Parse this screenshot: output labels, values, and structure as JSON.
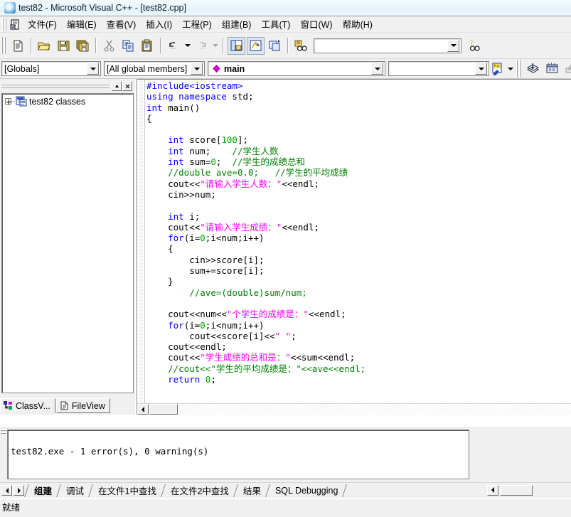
{
  "window": {
    "title": "test82 - Microsoft Visual C++ - [test82.cpp]",
    "app_icon": "vcpp-icon"
  },
  "menubar": {
    "items": [
      {
        "label": "文件(F)",
        "accel": "F"
      },
      {
        "label": "编辑(E)",
        "accel": "E"
      },
      {
        "label": "查看(V)",
        "accel": "V"
      },
      {
        "label": "插入(I)",
        "accel": "I"
      },
      {
        "label": "工程(P)",
        "accel": "P"
      },
      {
        "label": "组建(B)",
        "accel": "B"
      },
      {
        "label": "工具(T)",
        "accel": "T"
      },
      {
        "label": "窗口(W)",
        "accel": "W"
      },
      {
        "label": "帮助(H)",
        "accel": "H"
      }
    ]
  },
  "toolbar_standard": {
    "buttons": [
      "new-document-icon",
      "open-folder-icon",
      "save-icon",
      "save-all-icon",
      "cut-icon",
      "copy-icon",
      "paste-icon",
      "undo-icon",
      "redo-icon",
      "workspace-window-icon",
      "output-window-icon",
      "window-list-icon",
      "find-in-files-icon",
      "find-icon"
    ],
    "find_combo_value": "",
    "find_combo_placeholder": ""
  },
  "wizardbar": {
    "class_combo": "[Globals]",
    "members_combo": "[All global members]",
    "function_combo": "main",
    "function_icon": "member-function-icon",
    "action_combo": "",
    "action_icon": "wizardbar-action-icon",
    "buttons": [
      "compile-icon",
      "build-icon",
      "stop-build-icon",
      "execute-icon",
      "go-icon",
      "insert-breakpoint-icon"
    ]
  },
  "workspace": {
    "caption_buttons": [
      "minimize-icon",
      "close-icon"
    ],
    "tree": [
      {
        "label": "test82 classes",
        "icon": "class-folder-icon",
        "expanded": false
      }
    ],
    "tabs": [
      {
        "label": "ClassV...",
        "icon": "classview-icon",
        "active": true
      },
      {
        "label": "FileView",
        "icon": "fileview-icon",
        "active": false
      }
    ]
  },
  "editor": {
    "filename": "test82.cpp",
    "lines": [
      [
        {
          "t": "#include<iostream>",
          "c": "pp"
        }
      ],
      [
        {
          "t": "using namespace",
          "c": "kw"
        },
        {
          "t": " std;",
          "c": ""
        }
      ],
      [
        {
          "t": "int",
          "c": "kw"
        },
        {
          "t": " main()",
          "c": ""
        }
      ],
      [
        {
          "t": "{",
          "c": ""
        }
      ],
      [
        {
          "t": "",
          "c": ""
        }
      ],
      [
        {
          "t": "    ",
          "c": ""
        },
        {
          "t": "int",
          "c": "kw"
        },
        {
          "t": " score[",
          "c": ""
        },
        {
          "t": "100",
          "c": "num"
        },
        {
          "t": "];",
          "c": ""
        }
      ],
      [
        {
          "t": "    ",
          "c": ""
        },
        {
          "t": "int",
          "c": "kw"
        },
        {
          "t": " num;    ",
          "c": ""
        },
        {
          "t": "//学生人数",
          "c": "cmt"
        }
      ],
      [
        {
          "t": "    ",
          "c": ""
        },
        {
          "t": "int",
          "c": "kw"
        },
        {
          "t": " sum=",
          "c": ""
        },
        {
          "t": "0",
          "c": "num"
        },
        {
          "t": ";  ",
          "c": ""
        },
        {
          "t": "//学生的成绩总和",
          "c": "cmt"
        }
      ],
      [
        {
          "t": "    ",
          "c": ""
        },
        {
          "t": "//double ave=0.0;   //学生的平均成绩",
          "c": "cmt"
        }
      ],
      [
        {
          "t": "    cout<<",
          "c": ""
        },
        {
          "t": "\"请输入学生人数：\"",
          "c": "str"
        },
        {
          "t": "<<endl;",
          "c": ""
        }
      ],
      [
        {
          "t": "    cin>>num;",
          "c": ""
        }
      ],
      [
        {
          "t": "",
          "c": ""
        }
      ],
      [
        {
          "t": "    ",
          "c": ""
        },
        {
          "t": "int",
          "c": "kw"
        },
        {
          "t": " i;",
          "c": ""
        }
      ],
      [
        {
          "t": "    cout<<",
          "c": ""
        },
        {
          "t": "\"请输入学生成绩：\"",
          "c": "str"
        },
        {
          "t": "<<endl;",
          "c": ""
        }
      ],
      [
        {
          "t": "    ",
          "c": ""
        },
        {
          "t": "for",
          "c": "kw"
        },
        {
          "t": "(i=",
          "c": ""
        },
        {
          "t": "0",
          "c": "num"
        },
        {
          "t": ";i<num;i++)",
          "c": ""
        }
      ],
      [
        {
          "t": "    {",
          "c": ""
        }
      ],
      [
        {
          "t": "        cin>>score[i];",
          "c": ""
        }
      ],
      [
        {
          "t": "        sum+=score[i];",
          "c": ""
        }
      ],
      [
        {
          "t": "    }",
          "c": ""
        }
      ],
      [
        {
          "t": "        ",
          "c": ""
        },
        {
          "t": "//ave=(double)sum/num;",
          "c": "cmt"
        }
      ],
      [
        {
          "t": "",
          "c": ""
        }
      ],
      [
        {
          "t": "    cout<<num<<",
          "c": ""
        },
        {
          "t": "\"个学生的成绩是：\"",
          "c": "str"
        },
        {
          "t": "<<endl;",
          "c": ""
        }
      ],
      [
        {
          "t": "    ",
          "c": ""
        },
        {
          "t": "for",
          "c": "kw"
        },
        {
          "t": "(i=",
          "c": ""
        },
        {
          "t": "0",
          "c": "num"
        },
        {
          "t": ";i<num;i++)",
          "c": ""
        }
      ],
      [
        {
          "t": "        cout<<score[i]<<",
          "c": ""
        },
        {
          "t": "\" \"",
          "c": "str"
        },
        {
          "t": ";",
          "c": ""
        }
      ],
      [
        {
          "t": "    cout<<endl;",
          "c": ""
        }
      ],
      [
        {
          "t": "    cout<<",
          "c": ""
        },
        {
          "t": "\"学生成绩的总和是：\"",
          "c": "str"
        },
        {
          "t": "<<sum<<endl;",
          "c": ""
        }
      ],
      [
        {
          "t": "    ",
          "c": ""
        },
        {
          "t": "//cout<<\"学生的平均成绩是：\"<<ave<<endl;",
          "c": "cmt"
        }
      ],
      [
        {
          "t": "    ",
          "c": ""
        },
        {
          "t": "return",
          "c": "kw"
        },
        {
          "t": " ",
          "c": ""
        },
        {
          "t": "0",
          "c": "num"
        },
        {
          "t": ";",
          "c": ""
        }
      ]
    ]
  },
  "output": {
    "text": "test82.exe - 1 error(s), 0 warning(s)",
    "tabs": [
      {
        "label": "组建",
        "active": true
      },
      {
        "label": "调试",
        "active": false
      },
      {
        "label": "在文件1中查找",
        "active": false
      },
      {
        "label": "在文件2中查找",
        "active": false
      },
      {
        "label": "结果",
        "active": false
      },
      {
        "label": "SQL Debugging",
        "active": false
      }
    ]
  },
  "statusbar": {
    "message": "就绪"
  },
  "colors": {
    "keyword": "#0000ff",
    "number": "#00aa00",
    "string": "#ff00ff",
    "comment": "#008000",
    "text": "#000000",
    "chrome": "#f0f0f0",
    "title_gradient_top": "#f4fbfd",
    "title_gradient_bottom": "#e2f2f9"
  }
}
